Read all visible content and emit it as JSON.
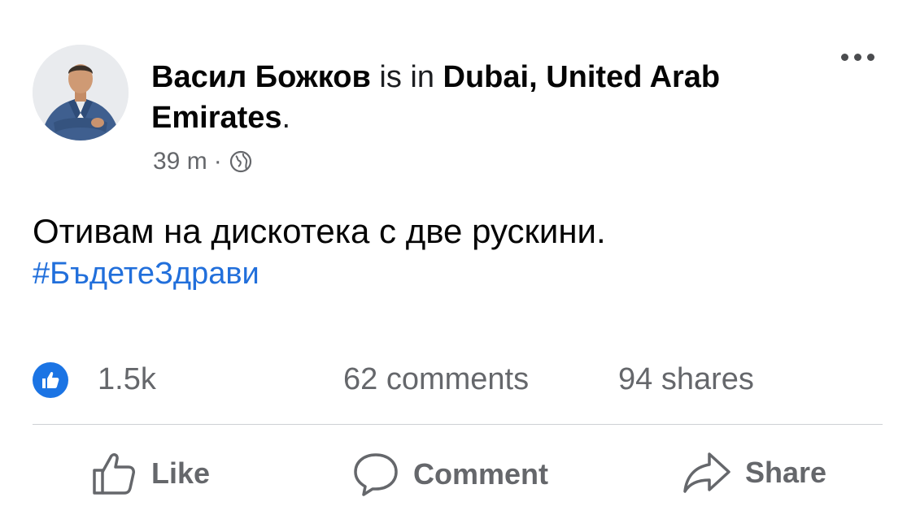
{
  "post": {
    "author": "Васил Божков",
    "connector": "is in",
    "location_line1": "Dubai, United Arab",
    "location_line2": "Emirates",
    "period": ".",
    "timestamp": "39 m",
    "separator": "·",
    "privacy_icon": "globe-icon",
    "text": "Отивам на дискотека с две рускини.",
    "hashtag": "#БъдетеЗдрави"
  },
  "stats": {
    "reaction_icon": "like-reaction-icon",
    "reactions": "1.5k",
    "comments": "62 comments",
    "shares": "94 shares"
  },
  "actions": {
    "like": "Like",
    "comment": "Comment",
    "share": "Share"
  },
  "colors": {
    "link": "#216fdb",
    "like_badge": "#1b74e4",
    "muted_text": "#65676b"
  }
}
